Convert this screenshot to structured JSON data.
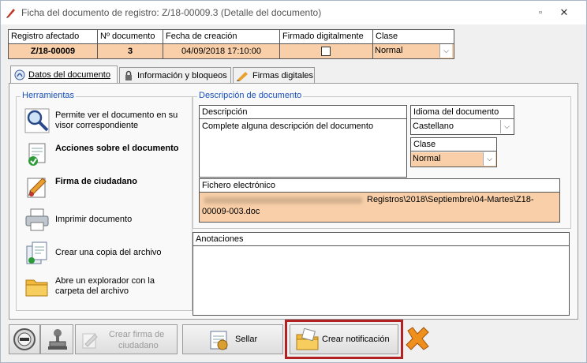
{
  "window": {
    "title": "Ficha del documento de registro: Z/18-00009.3 (Detalle del documento)",
    "maximize_glyph": "▫",
    "close_glyph": "✕"
  },
  "header": {
    "columns": [
      "Registro afectado",
      "Nº documento",
      "Fecha de creación",
      "Firmado digitalmente",
      "Clase"
    ],
    "registro": "Z/18-00009",
    "numero": "3",
    "fecha": "04/09/2018 17:10:00",
    "firmado": false,
    "clase": "Normal"
  },
  "tabs": [
    {
      "label": "Datos del documento",
      "icon": "document-icon",
      "active": true
    },
    {
      "label": "Información y bloqueos",
      "icon": "info-lock-icon",
      "active": false
    },
    {
      "label": "Firmas digitales",
      "icon": "signature-icon",
      "active": false
    }
  ],
  "tools": {
    "title": "Herramientas",
    "items": [
      {
        "label": "Permite ver el documento en su visor correspondiente",
        "icon": "magnifier-icon",
        "bold": false
      },
      {
        "label": "Acciones sobre el documento",
        "icon": "document-actions-icon",
        "bold": true
      },
      {
        "label": "Firma de ciudadano",
        "icon": "pen-sign-icon",
        "bold": true
      },
      {
        "label": "Imprimir documento",
        "icon": "printer-icon",
        "bold": false
      },
      {
        "label": "Crear una copia del archivo",
        "icon": "copy-file-icon",
        "bold": false
      },
      {
        "label": "Abre un explorador con la carpeta del archivo",
        "icon": "folder-icon",
        "bold": false
      }
    ]
  },
  "descripcion_doc": {
    "title": "Descripción de documento",
    "descripcion_label": "Descripción",
    "descripcion_value": "Complete alguna descripción del documento",
    "idioma_label": "Idioma del documento",
    "idioma_value": "Castellano",
    "clase_label": "Clase",
    "clase_value": "Normal",
    "fichero_label": "Fichero electrónico",
    "fichero_value_line1": "Registros\\2018\\Septiembre\\04-Martes\\Z18-",
    "fichero_value_line2": "00009-003.doc"
  },
  "anotaciones": {
    "label": "Anotaciones",
    "value": ""
  },
  "buttons": {
    "back": {
      "icon": "back-icon"
    },
    "stamp": {
      "icon": "stamp-icon"
    },
    "crear_firma": {
      "label_line1": "Crear firma de",
      "label_line2": "ciudadano",
      "enabled": false
    },
    "sellar": {
      "label": "Sellar",
      "enabled": true
    },
    "crear_notificacion": {
      "label": "Crear notificación",
      "enabled": true
    },
    "cancel": {
      "icon": "cancel-cross-icon"
    }
  },
  "colors": {
    "accent_blue": "#1a50b8",
    "value_cell_bg": "#f8cfa8",
    "highlight_red": "#b22222"
  }
}
